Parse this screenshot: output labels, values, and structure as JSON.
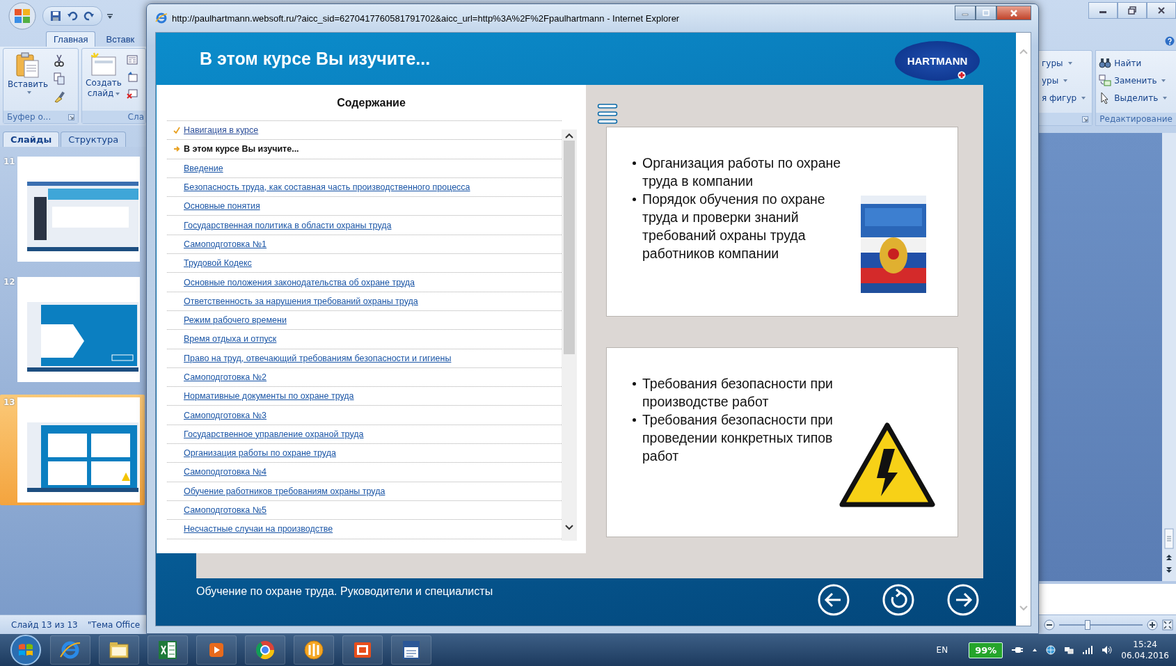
{
  "powerpoint": {
    "ribbon_tabs": [
      {
        "label": "Главная",
        "selected": true
      },
      {
        "label": "Вставк",
        "selected": false
      }
    ],
    "clipboard_group": {
      "paste": "Вставить",
      "label": "Буфер о..."
    },
    "slides_group": {
      "new_slide": "Создать слайд",
      "label": "Сла"
    },
    "drawing_group": {
      "items": [
        {
          "label": "гуры",
          "dropdown": true
        },
        {
          "label": "уры",
          "dropdown": true
        },
        {
          "label": "я фигур",
          "dropdown": true
        }
      ]
    },
    "editing_group": {
      "items": [
        {
          "label": "Найти",
          "dropdown": false
        },
        {
          "label": "Заменить",
          "dropdown": true
        },
        {
          "label": "Выделить",
          "dropdown": true
        }
      ],
      "label": "Редактирование"
    },
    "panel_tabs": [
      {
        "label": "Слайды",
        "selected": true
      },
      {
        "label": "Структура",
        "selected": false
      }
    ],
    "slides": [
      {
        "number": "11",
        "selected": false
      },
      {
        "number": "12",
        "selected": false
      },
      {
        "number": "13",
        "selected": true
      }
    ],
    "status_bar": [
      "Слайд 13 из 13",
      "\"Тема Office"
    ],
    "zoom": {
      "level": 0.34
    }
  },
  "browser": {
    "title": "http://paulhartmann.websoft.ru/?aicc_sid=6270417760581791702&aicc_url=http%3A%2F%2Fpaulhartmann - Internet Explorer",
    "course": {
      "title": "В этом курсе Вы изучите...",
      "logo": "HARTMANN",
      "contents": {
        "heading": "Содержание",
        "items": [
          {
            "label": "Навигация в курсе",
            "visited": true,
            "selected": false
          },
          {
            "label": "В этом курсе Вы изучите...",
            "visited": false,
            "selected": true
          },
          {
            "label": "Введение",
            "visited": false,
            "selected": false
          },
          {
            "label": "Безопасность труда, как составная часть производственного процесса",
            "visited": false,
            "selected": false
          },
          {
            "label": "Основные понятия",
            "visited": false,
            "selected": false
          },
          {
            "label": "Государственная политика в области охраны труда",
            "visited": false,
            "selected": false
          },
          {
            "label": "Самоподготовка №1",
            "visited": false,
            "selected": false
          },
          {
            "label": "Трудовой Кодекс",
            "visited": false,
            "selected": false
          },
          {
            "label": "Основные положения законодательства об охране труда",
            "visited": false,
            "selected": false
          },
          {
            "label": "Ответственность за нарушения требований охраны труда",
            "visited": false,
            "selected": false
          },
          {
            "label": "Режим рабочего времени",
            "visited": false,
            "selected": false
          },
          {
            "label": "Время отдыха и отпуск",
            "visited": false,
            "selected": false
          },
          {
            "label": "Право на труд, отвечающий требованиям безопасности и гигиены",
            "visited": false,
            "selected": false
          },
          {
            "label": "Самоподготовка №2",
            "visited": false,
            "selected": false
          },
          {
            "label": "Нормативные документы по охране труда",
            "visited": false,
            "selected": false
          },
          {
            "label": "Самоподготовка №3",
            "visited": false,
            "selected": false
          },
          {
            "label": "Государственное управление охраной труда",
            "visited": false,
            "selected": false
          },
          {
            "label": "Организация работы по охране труда",
            "visited": false,
            "selected": false
          },
          {
            "label": "Самоподготовка №4",
            "visited": false,
            "selected": false
          },
          {
            "label": "Обучение работников требованиям охраны труда",
            "visited": false,
            "selected": false
          },
          {
            "label": "Самоподготовка №5",
            "visited": false,
            "selected": false
          },
          {
            "label": "Несчастные случаи на производстве",
            "visited": false,
            "selected": false
          }
        ]
      },
      "cards": [
        {
          "kind": "picture",
          "bullets": [
            "Организация работы по охране труда в компании",
            "Порядок обучения по охране труда и проверки знаний требований охраны труда работников компании"
          ]
        },
        {
          "kind": "sign",
          "bullets": [
            "Требования безопасности при производстве работ",
            "Требования безопасности при проведении конкретных типов работ"
          ]
        }
      ],
      "footer": "Обучение по охране труда. Руководители и специалисты"
    }
  },
  "taskbar": {
    "language": "EN",
    "battery": "99%",
    "time": "15:24",
    "date": "06.04.2016"
  }
}
